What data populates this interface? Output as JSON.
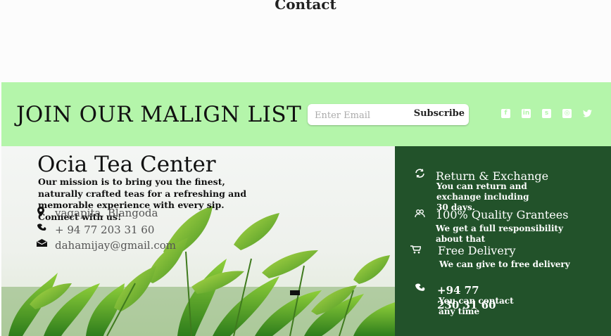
{
  "header": {
    "title": "Contact"
  },
  "newsletter": {
    "title": "JOIN OUR MALIGN LIST",
    "email_placeholder": "Enter Email",
    "subscribe_label": "Subscribe",
    "socials": [
      {
        "icon": "facebook-icon",
        "glyph": "f"
      },
      {
        "icon": "linkedin-icon",
        "glyph": "in"
      },
      {
        "icon": "snapchat-icon",
        "glyph": "s"
      },
      {
        "icon": "instagram-icon",
        "glyph": "◎"
      },
      {
        "icon": "twitter-icon",
        "glyph": "t"
      }
    ]
  },
  "company": {
    "name": "Ocia Tea Center",
    "mission": "Our mission is to bring you the finest, naturally crafted teas for a refreshing and memorable experience with every sip. Connect with us!",
    "address": "vagapita, Blangoda",
    "phone": "+ 94 77 203 31 60",
    "email": "dahamijay@gmail.com"
  },
  "features": [
    {
      "icon": "refresh-icon",
      "title": "Return & Exchange",
      "desc": "You can return and exchange including 30 days."
    },
    {
      "icon": "handshake-icon",
      "title": "100% Quality Grantees",
      "desc": "We get a full responsibility about that"
    },
    {
      "icon": "cart-icon",
      "title": "Free Delivery",
      "desc": "We can give to free delivery"
    },
    {
      "icon": "phone-icon",
      "title": "+94 77 230 31 60",
      "desc": "You can contact any time"
    }
  ],
  "colors": {
    "accent_light": "#b4f5aa",
    "accent_dark": "#22522a"
  }
}
